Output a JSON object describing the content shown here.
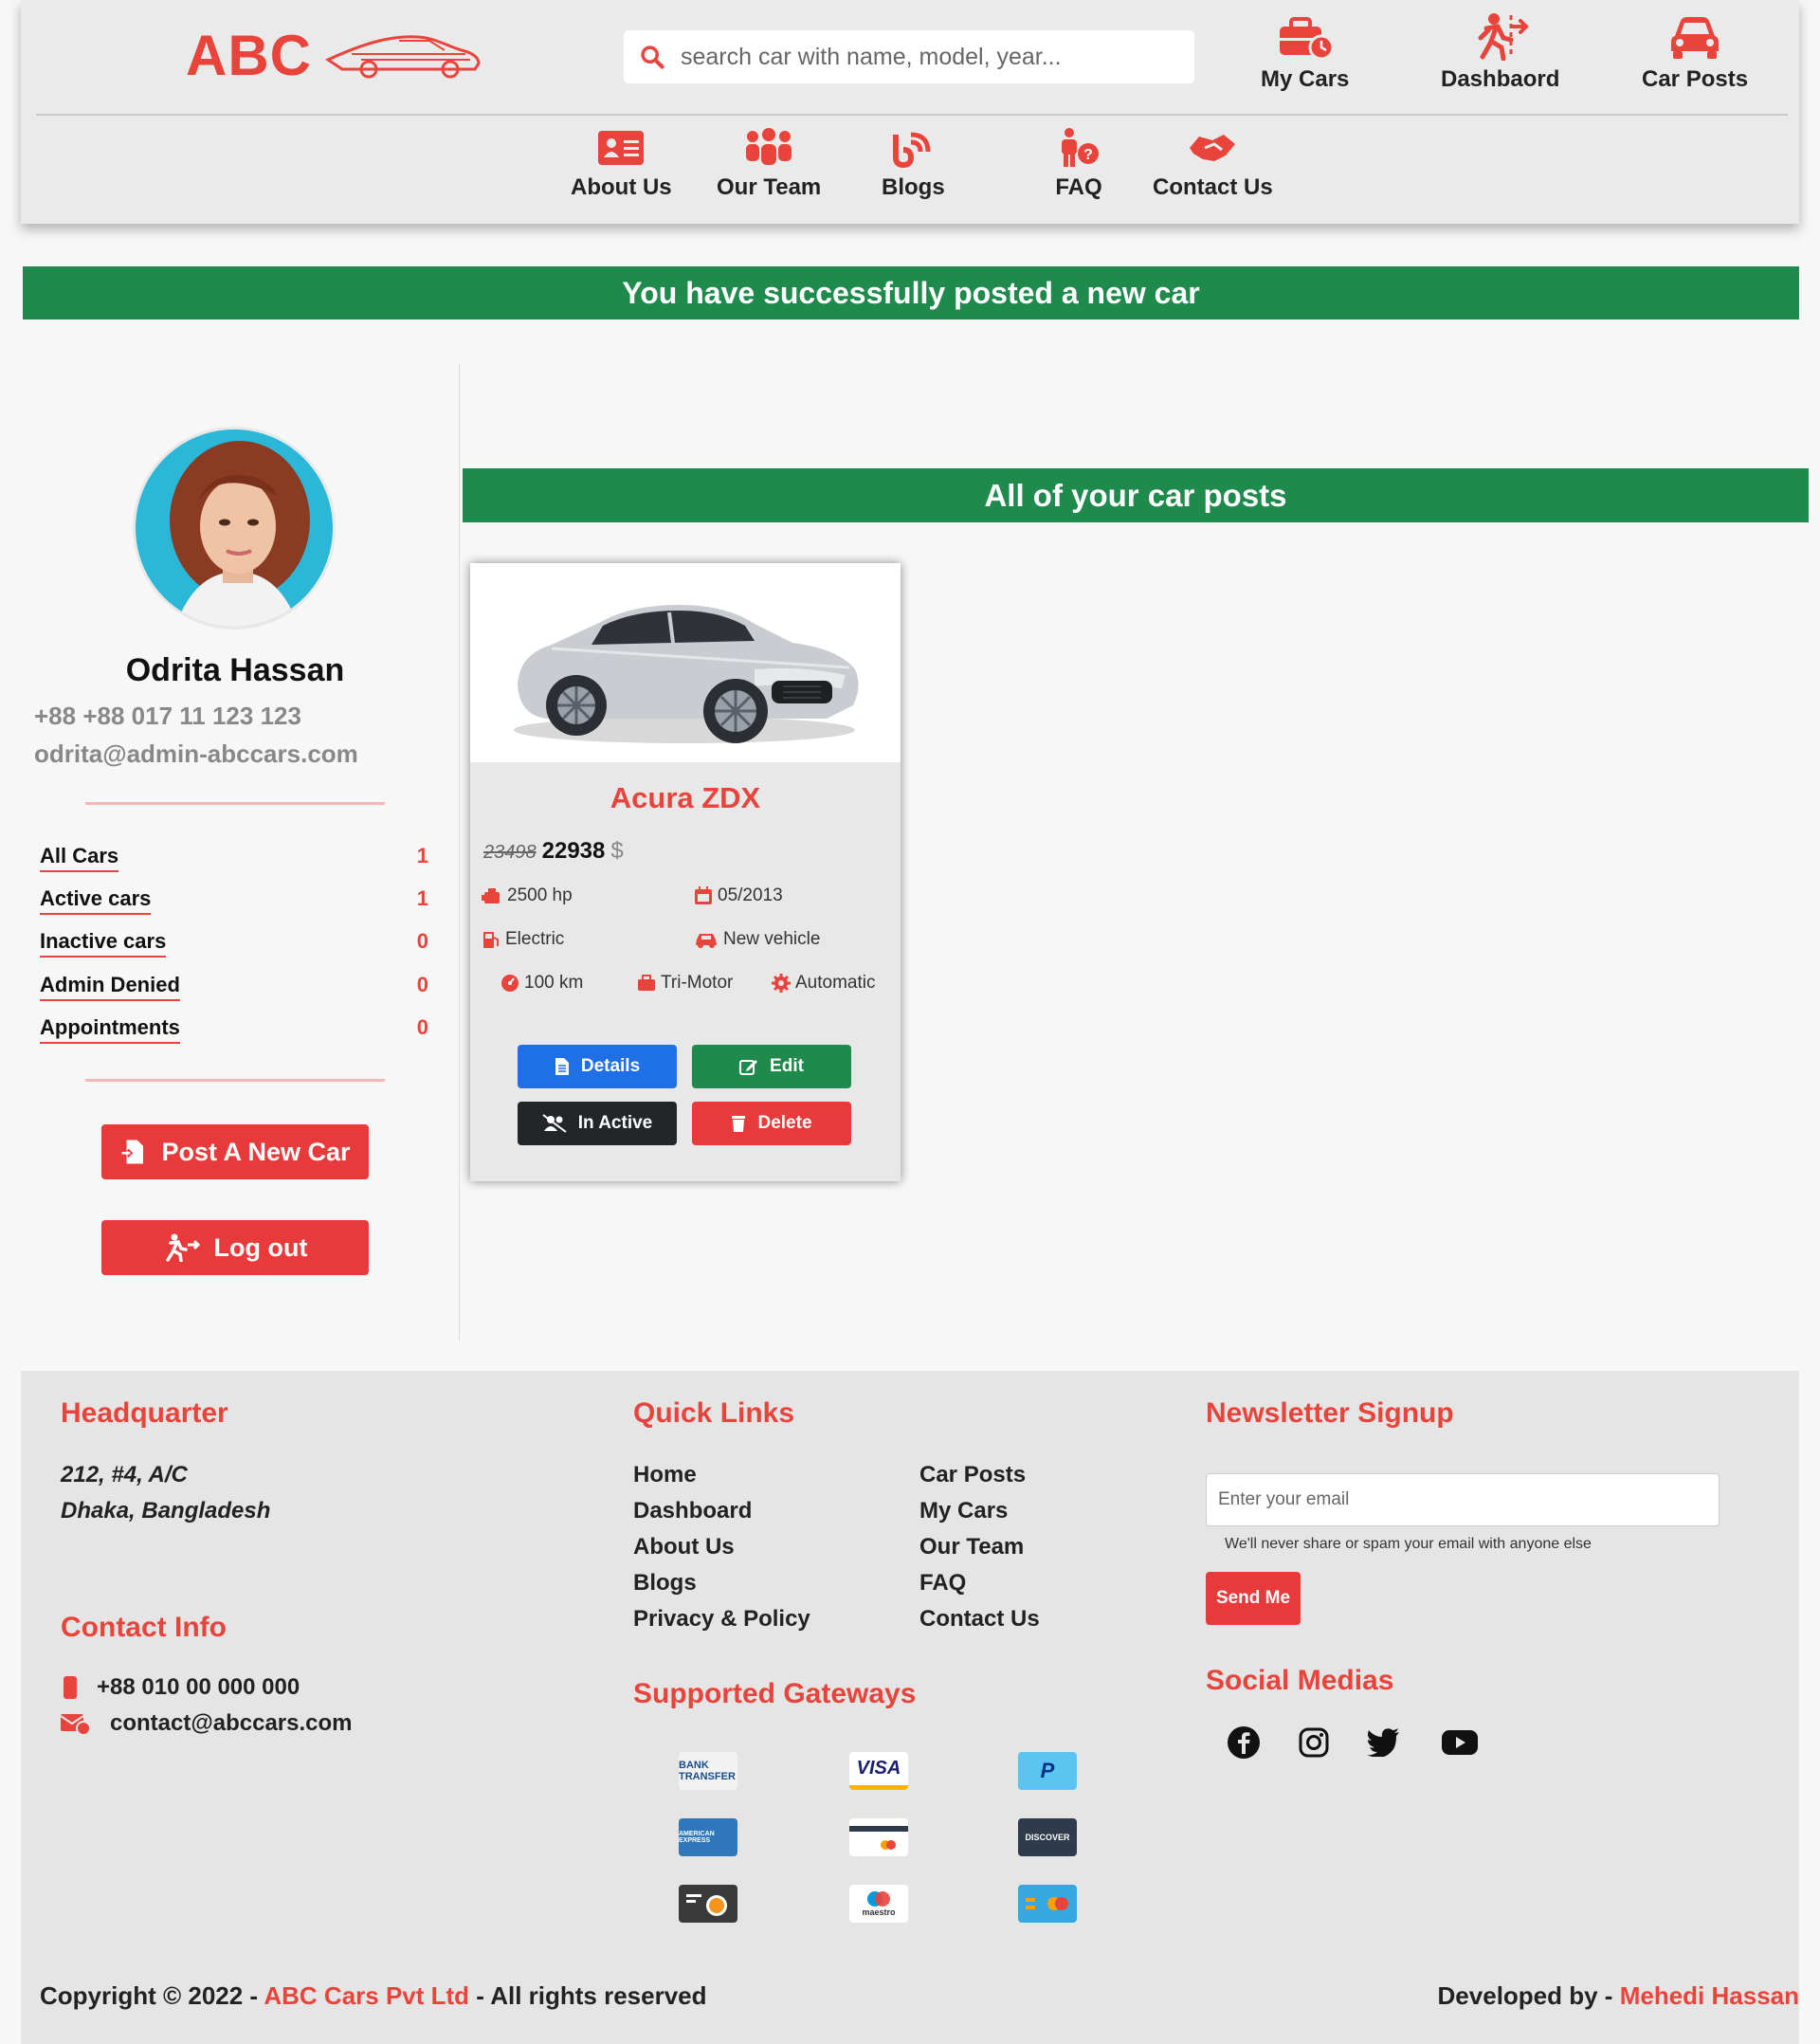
{
  "brand": {
    "logo_text": "ABC",
    "accent": "#e8443b",
    "success": "#1e8a4c"
  },
  "search": {
    "placeholder": "search car with name, model, year..."
  },
  "header_nav": [
    {
      "label": "My Cars",
      "icon": "briefcase-clock-icon"
    },
    {
      "label": "Dashbaord",
      "icon": "person-exit-icon"
    },
    {
      "label": "Car Posts",
      "icon": "car-icon"
    }
  ],
  "sub_nav": [
    {
      "label": "About Us",
      "icon": "id-card-icon"
    },
    {
      "label": "Our Team",
      "icon": "team-icon"
    },
    {
      "label": "Blogs",
      "icon": "blog-icon"
    },
    {
      "label": "FAQ",
      "icon": "person-question-icon"
    },
    {
      "label": "Contact Us",
      "icon": "handshake-icon"
    }
  ],
  "alert": {
    "text": "You have successfully posted a new car"
  },
  "profile": {
    "name": "Odrita Hassan",
    "phone": "+88 +88 017 11 123 123",
    "email": "odrita@admin-abccars.com"
  },
  "stats": [
    {
      "label": "All Cars",
      "value": "1"
    },
    {
      "label": "Active cars",
      "value": "1"
    },
    {
      "label": "Inactive cars",
      "value": "0"
    },
    {
      "label": "Admin Denied",
      "value": "0"
    },
    {
      "label": "Appointments",
      "value": "0"
    }
  ],
  "sidebar_buttons": {
    "post": "Post A New Car",
    "logout": "Log out"
  },
  "posts": {
    "banner": "All of your car posts",
    "car": {
      "title": "Acura ZDX",
      "old_price": "23498",
      "price": "22938",
      "currency": "$",
      "power": "2500 hp",
      "date": "05/2013",
      "fuel": "Electric",
      "condition": "New vehicle",
      "mileage": "100 km",
      "motor": "Tri-Motor",
      "transmission": "Automatic",
      "buttons": {
        "details": "Details",
        "edit": "Edit",
        "inactive": "In Active",
        "delete": "Delete"
      }
    }
  },
  "footer": {
    "hq": {
      "heading": "Headquarter",
      "line1": "212, #4, A/C",
      "line2": "Dhaka, Bangladesh"
    },
    "contact": {
      "heading": "Contact Info",
      "phone": "+88 010 00 000 000",
      "email": "contact@abccars.com"
    },
    "quick_links": {
      "heading": "Quick Links",
      "col1": [
        "Home",
        "Dashboard",
        "About Us",
        "Blogs",
        "Privacy & Policy"
      ],
      "col2": [
        "Car Posts",
        "My Cars",
        "Our Team",
        "FAQ",
        "Contact Us"
      ]
    },
    "gateways": {
      "heading": "Supported Gateways",
      "items": [
        "BANK TRANSFER",
        "VISA",
        "P",
        "AMERICAN EXPRESS",
        "",
        "DISCOVER",
        "",
        "maestro",
        ""
      ]
    },
    "newsletter": {
      "heading": "Newsletter Signup",
      "placeholder": "Enter your email",
      "note": "We'll never share or spam your email with anyone else",
      "button": "Send Me"
    },
    "social": {
      "heading": "Social Medias",
      "icons": [
        "facebook-icon",
        "instagram-icon",
        "twitter-icon",
        "youtube-icon"
      ]
    },
    "copyright": {
      "prefix": "Copyright © 2022 -",
      "company": "ABC Cars Pvt Ltd",
      "suffix": "- All rights reserved"
    },
    "developer": {
      "prefix": "Developed by -",
      "name": "Mehedi Hassan"
    }
  }
}
